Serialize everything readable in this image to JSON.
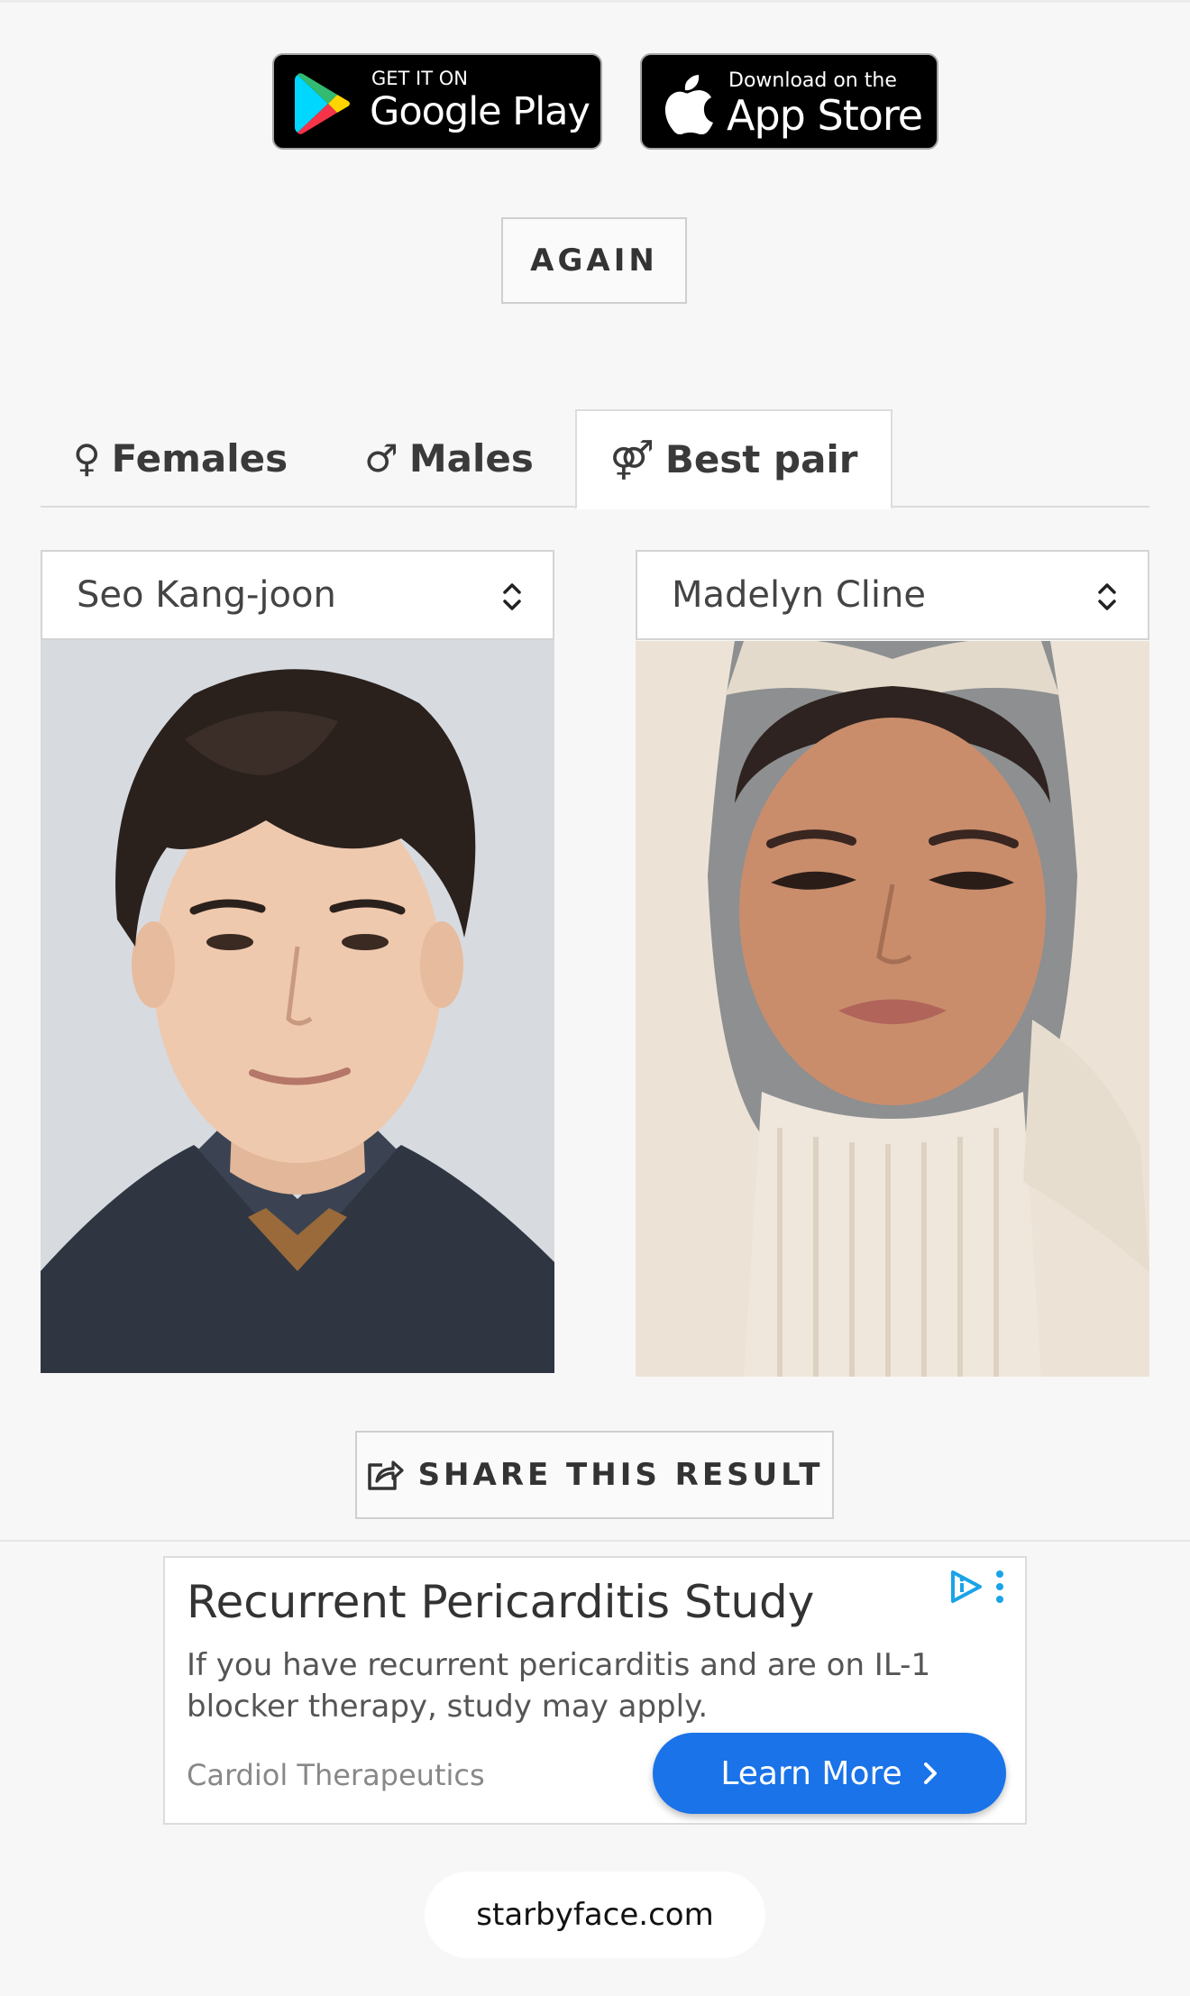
{
  "store_badges": {
    "google": {
      "small": "GET IT ON",
      "big": "Google Play",
      "icon": "google-play-icon"
    },
    "apple": {
      "small": "Download on the",
      "big": "App Store",
      "icon": "apple-icon"
    }
  },
  "again_label": "AGAIN",
  "tabs": [
    {
      "symbol": "♀",
      "label": "Females",
      "icon": "female-icon",
      "active": false
    },
    {
      "symbol": "♂",
      "label": "Males",
      "icon": "male-icon",
      "active": false
    },
    {
      "symbol": "⚤",
      "label": "Best pair",
      "icon": "pair-icon",
      "active": true
    }
  ],
  "selects": {
    "left": {
      "value": "Seo Kang-joon"
    },
    "right": {
      "value": "Madelyn Cline"
    }
  },
  "share_label": "SHARE THIS RESULT",
  "ad": {
    "title": "Recurrent Pericarditis Study",
    "body": "If you have recurrent pericarditis and are on IL-1 blocker therapy, study may apply.",
    "brand": "Cardiol Therapeutics",
    "cta": "Learn More",
    "accent": "#1a73e8"
  },
  "url": "starbyface.com"
}
